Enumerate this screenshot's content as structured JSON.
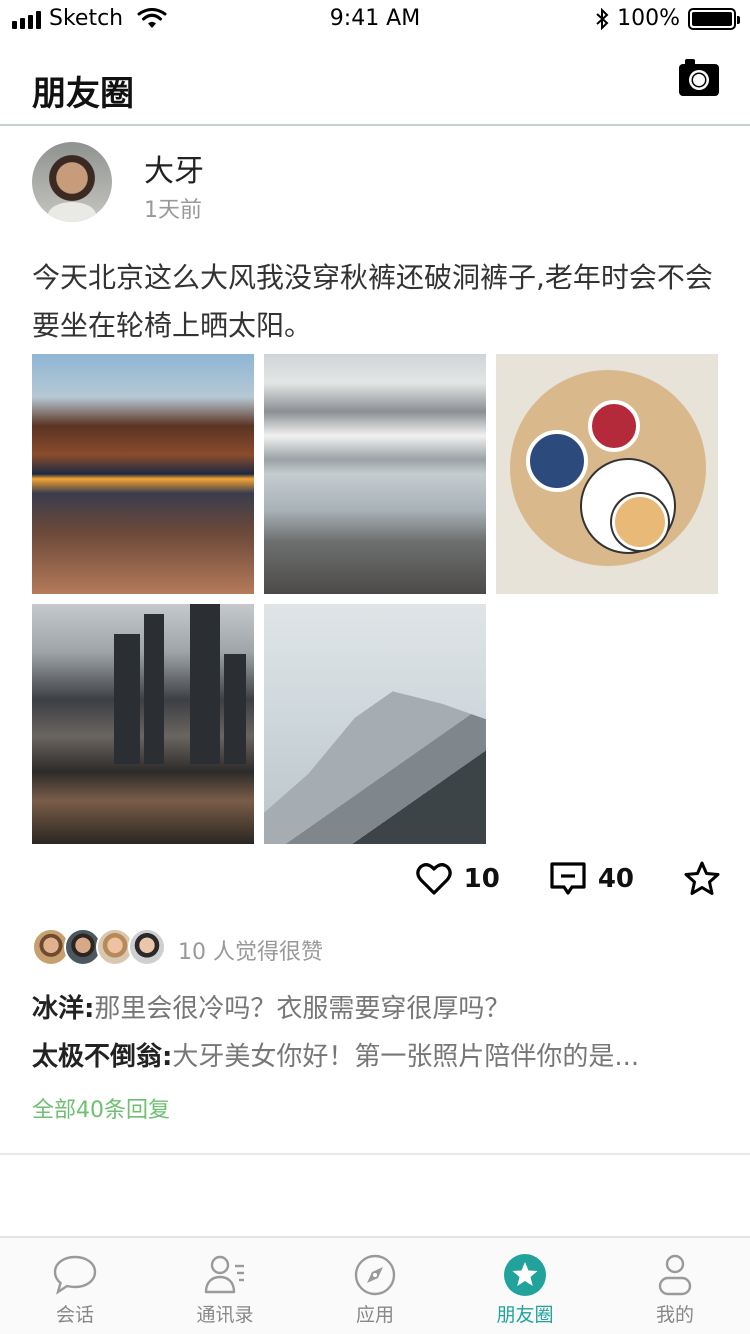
{
  "status_bar": {
    "carrier": "Sketch",
    "time": "9:41 AM",
    "battery": "100%"
  },
  "header": {
    "title": "朋友圈",
    "camera_icon": "camera-icon"
  },
  "post": {
    "author": "大牙",
    "time": "1天前",
    "text": "今天北京这么大风我没穿秋裤还破洞裤子,老年时会不会要坐在轮椅上晒太阳。",
    "photo_count": 5,
    "like_count": "10",
    "comment_count": "40",
    "likes_summary": "10 人觉得很赞",
    "comments": [
      {
        "name": "冰洋:",
        "text": "那里会很冷吗？衣服需要穿很厚吗？"
      },
      {
        "name": "太极不倒翁:",
        "text": "大牙美女你好！第一张照片陪伴你的是..."
      }
    ],
    "all_replies": "全部40条回复"
  },
  "tabs": [
    {
      "label": "会话",
      "icon": "chat-bubble-icon",
      "active": false
    },
    {
      "label": "通讯录",
      "icon": "contacts-icon",
      "active": false
    },
    {
      "label": "应用",
      "icon": "compass-icon",
      "active": false
    },
    {
      "label": "朋友圈",
      "icon": "star-circle-icon",
      "active": true
    },
    {
      "label": "我的",
      "icon": "person-icon",
      "active": false
    }
  ],
  "colors": {
    "accent": "#21a39b",
    "link_green": "#6fbf73"
  }
}
